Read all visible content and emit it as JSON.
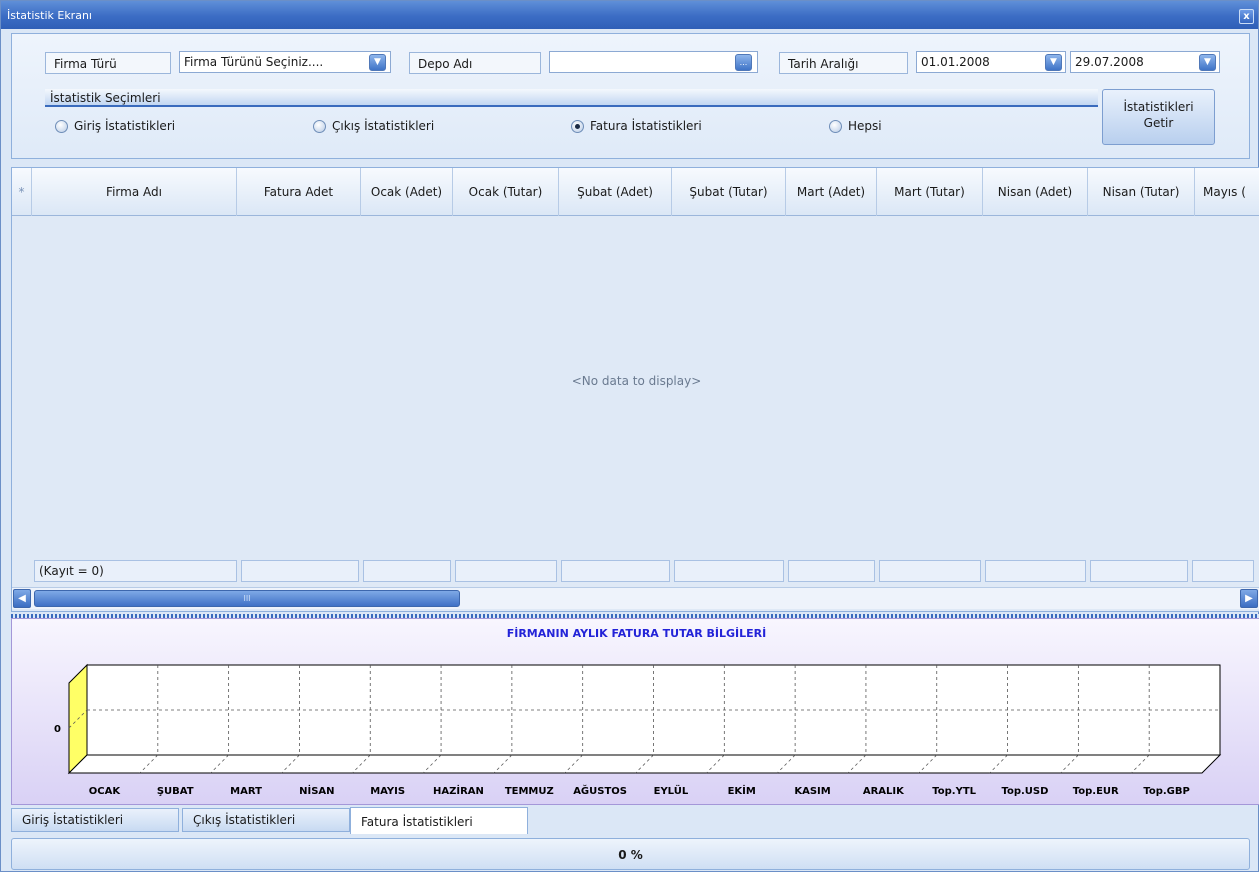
{
  "window": {
    "title": "İstatistik Ekranı",
    "close_glyph": "x"
  },
  "filters": {
    "firma_turu_label": "Firma Türü",
    "firma_turu_value": "Firma Türünü Seçiniz....",
    "depo_label": "Depo Adı",
    "depo_value": "",
    "depo_button_glyph": "...",
    "tarih_label": "Tarih Aralığı",
    "tarih_start": "01.01.2008",
    "tarih_end": "29.07.2008"
  },
  "stat_group": {
    "title": "İstatistik Seçimleri",
    "options": [
      {
        "label": "Giriş İstatistikleri",
        "selected": false
      },
      {
        "label": "Çıkış İstatistikleri",
        "selected": false
      },
      {
        "label": "Fatura İstatistikleri",
        "selected": true
      },
      {
        "label": "Hepsi",
        "selected": false
      }
    ]
  },
  "get_button": {
    "line1": "İstatistikleri",
    "line2": "Getir"
  },
  "grid": {
    "new_row_glyph": "*",
    "columns": [
      "Firma Adı",
      "Fatura Adet",
      "Ocak (Adet)",
      "Ocak (Tutar)",
      "Şubat (Adet)",
      "Şubat (Tutar)",
      "Mart (Adet)",
      "Mart (Tutar)",
      "Nisan (Adet)",
      "Nisan (Tutar)",
      "Mayıs ("
    ],
    "empty_text": "<No data to display>",
    "footer_count": "(Kayıt = 0)"
  },
  "scroll": {
    "thumb_grip": "III",
    "position_fraction": 0
  },
  "chart_data": {
    "type": "bar",
    "title": "FİRMANIN AYLIK FATURA TUTAR BİLGİLERİ",
    "categories": [
      "OCAK",
      "ŞUBAT",
      "MART",
      "NİSAN",
      "MAYIS",
      "HAZİRAN",
      "TEMMUZ",
      "AĞUSTOS",
      "EYLÜL",
      "EKİM",
      "KASIM",
      "ARALIK",
      "Top.YTL",
      "Top.USD",
      "Top.EUR",
      "Top.GBP"
    ],
    "y_ticks": [
      "0"
    ],
    "series": [
      {
        "values": [
          0,
          0,
          0,
          0,
          0,
          0,
          0,
          0,
          0,
          0,
          0,
          0,
          0,
          0,
          0,
          0
        ]
      }
    ],
    "ylim": [
      -1,
      1
    ],
    "grid": true,
    "legend": "none",
    "colors": {
      "axis_wall": "#ffff66",
      "title": "#2323d8",
      "grid": "#555555"
    }
  },
  "tabs": [
    {
      "label": "Giriş İstatistikleri",
      "active": false
    },
    {
      "label": "Çıkış İstatistikleri",
      "active": false
    },
    {
      "label": "Fatura İstatistikleri",
      "active": true
    }
  ],
  "status": {
    "progress_text": "0 %",
    "progress_fraction": 0
  }
}
